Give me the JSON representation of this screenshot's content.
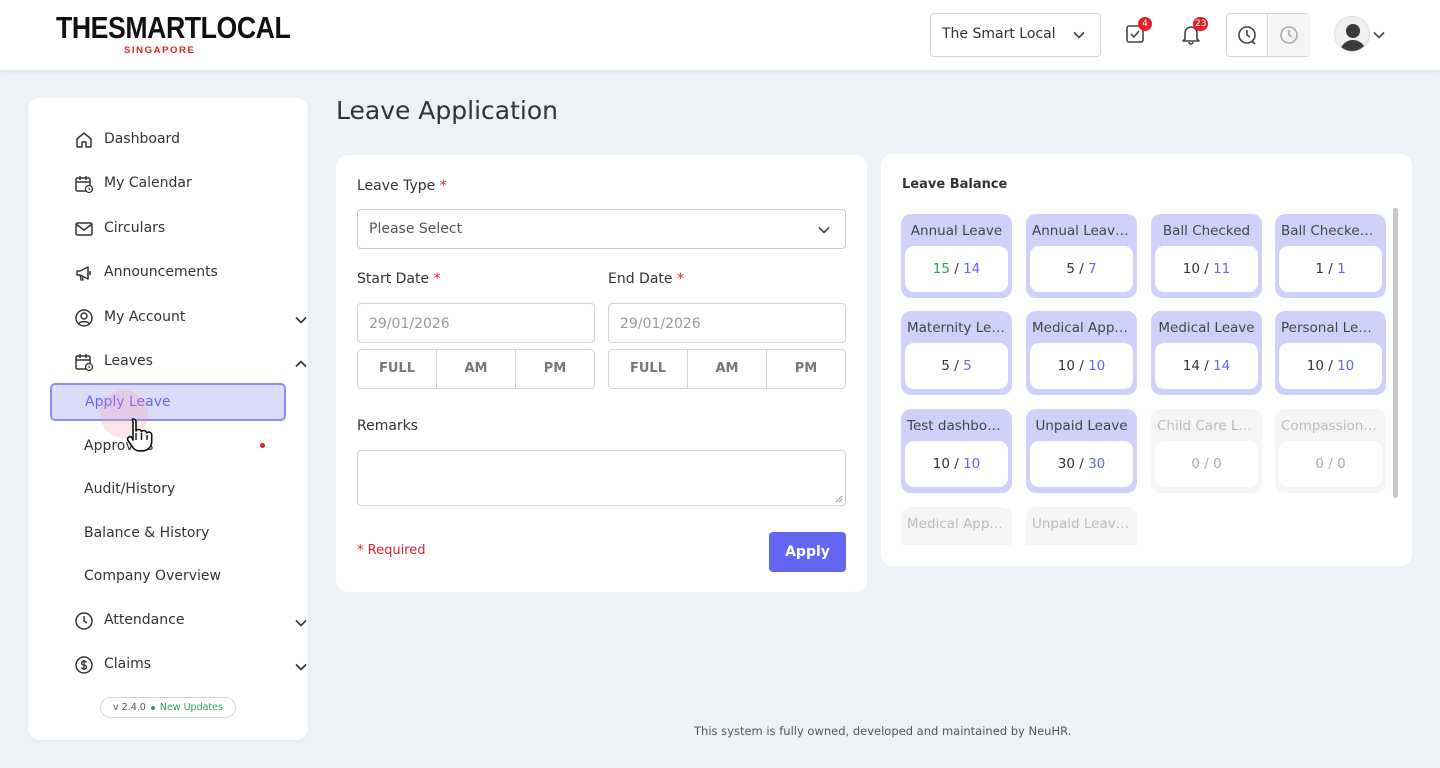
{
  "header": {
    "logo_main": "THESMARTLOCAL",
    "logo_sub": "SINGAPORE",
    "company": "The Smart Local",
    "tasks_badge": "4",
    "notifications_badge": "23"
  },
  "sidebar": {
    "items": [
      {
        "label": "Dashboard",
        "icon": "home-icon"
      },
      {
        "label": "My Calendar",
        "icon": "calendar-icon"
      },
      {
        "label": "Circulars",
        "icon": "mail-icon"
      },
      {
        "label": "Announcements",
        "icon": "megaphone-icon"
      },
      {
        "label": "My Account",
        "icon": "user-circle-icon"
      },
      {
        "label": "Leaves",
        "icon": "calendar-icon"
      },
      {
        "label": "Attendance",
        "icon": "clock-icon"
      },
      {
        "label": "Claims",
        "icon": "dollar-icon"
      }
    ],
    "leaves_sub": [
      {
        "label": "Apply Leave",
        "active": true
      },
      {
        "label": "Approvals"
      },
      {
        "label": "Audit/History"
      },
      {
        "label": "Balance & History"
      },
      {
        "label": "Company Overview"
      }
    ],
    "version": "v 2.4.0",
    "new_updates": "New Updates"
  },
  "main": {
    "title": "Leave Application",
    "form": {
      "leave_type_label": "Leave Type",
      "leave_type_value": "Please Select",
      "start_date_label": "Start Date",
      "start_date_value": "29/01/2026",
      "end_date_label": "End Date",
      "end_date_value": "29/01/2026",
      "segments": [
        "FULL",
        "AM",
        "PM"
      ],
      "remarks_label": "Remarks",
      "required_star": "*",
      "required_note": "* Required",
      "apply_label": "Apply"
    },
    "balance": {
      "title": "Leave Balance",
      "tiles": [
        {
          "name": "Annual Leave",
          "used": "15",
          "total": "14"
        },
        {
          "name": "Annual Leave…",
          "used": "5",
          "total": "7"
        },
        {
          "name": "Ball Checked",
          "used": "10",
          "total": "11"
        },
        {
          "name": "Ball Checked …",
          "used": "1",
          "total": "1"
        },
        {
          "name": "Maternity Lea…",
          "used": "5",
          "total": "5"
        },
        {
          "name": "Medical Appo…",
          "used": "10",
          "total": "10"
        },
        {
          "name": "Medical Leave",
          "used": "14",
          "total": "14"
        },
        {
          "name": "Personal Leave",
          "used": "10",
          "total": "10"
        },
        {
          "name": "Test dashboa…",
          "used": "10",
          "total": "10"
        },
        {
          "name": "Unpaid Leave",
          "used": "30",
          "total": "30"
        },
        {
          "name": "Child Care Le…",
          "used": "0",
          "total": "0"
        },
        {
          "name": "Compassiona…",
          "used": "0",
          "total": "0"
        },
        {
          "name": "Medical Appo…"
        },
        {
          "name": "Unpaid Leave…"
        }
      ]
    },
    "footer": "This system is fully owned, developed and maintained by NeuHR."
  }
}
